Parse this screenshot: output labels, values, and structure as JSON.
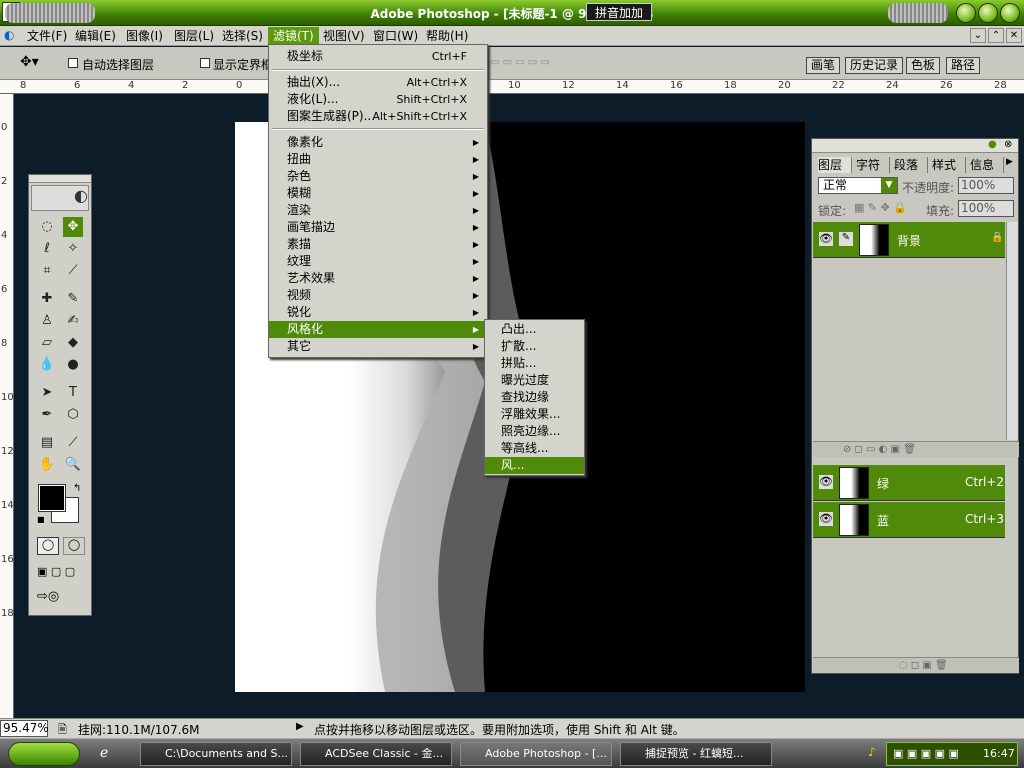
{
  "window": {
    "title": "Adobe Photoshop - [未标题-1 @ 95.5%(RGB",
    "ime_label": "拼音加加"
  },
  "menubar": {
    "items": [
      "文件(F)",
      "编辑(E)",
      "图像(I)",
      "图层(L)",
      "选择(S)",
      "滤镜(T)",
      "视图(V)",
      "窗口(W)",
      "帮助(H)"
    ],
    "active": "滤镜(T)"
  },
  "options": {
    "auto_select": "自动选择图层",
    "show_bounds": "显示定界框",
    "palette_tabs": [
      "画笔",
      "历史记录",
      "色板",
      "路径"
    ]
  },
  "rulers": {
    "top": [
      "8",
      "6",
      "4",
      "2",
      "0",
      "10",
      "12",
      "14",
      "16",
      "18",
      "20",
      "22",
      "24",
      "26",
      "28"
    ],
    "left": [
      "0",
      "2",
      "4",
      "6",
      "8",
      "10",
      "12",
      "14",
      "16",
      "18"
    ]
  },
  "filter_menu": {
    "top_items": [
      {
        "label": "极坐标",
        "shortcut": "Ctrl+F"
      }
    ],
    "mid_items": [
      {
        "label": "抽出(X)...",
        "shortcut": "Alt+Ctrl+X"
      },
      {
        "label": "液化(L)...",
        "shortcut": "Shift+Ctrl+X"
      },
      {
        "label": "图案生成器(P)...",
        "shortcut": "Alt+Shift+Ctrl+X"
      }
    ],
    "sub_items": [
      "像素化",
      "扭曲",
      "杂色",
      "模糊",
      "渲染",
      "画笔描边",
      "素描",
      "纹理",
      "艺术效果",
      "视频",
      "锐化",
      "风格化",
      "其它"
    ],
    "highlighted": "风格化"
  },
  "stylize_submenu": {
    "items": [
      "凸出...",
      "扩散...",
      "拼贴...",
      "曝光过度",
      "查找边缘",
      "浮雕效果...",
      "照亮边缘...",
      "等高线...",
      "风..."
    ],
    "highlighted": "风..."
  },
  "layers_panel": {
    "tabs": [
      "图层",
      "字符",
      "段落",
      "样式",
      "信息"
    ],
    "blend_mode": "正常",
    "opacity_label": "不透明度:",
    "opacity": "100%",
    "lock_label": "锁定:",
    "fill_label": "填充:",
    "fill": "100%",
    "layers": [
      {
        "name": "背景"
      }
    ],
    "channels": [
      {
        "name": "绿",
        "shortcut": "Ctrl+2"
      },
      {
        "name": "蓝",
        "shortcut": "Ctrl+3"
      }
    ]
  },
  "status": {
    "zoom": "95.47%",
    "doc": "挂网:110.1M/107.6M",
    "hint": "点按并拖移以移动图层或选区。要用附加选项，使用 Shift 和 Alt 键。"
  },
  "taskbar": {
    "tasks": [
      "C:\\Documents and S...",
      "ACDSee Classic - 金...",
      "Adobe Photoshop - [...",
      "捕捉预览 - 红螭短..."
    ],
    "active_index": 2,
    "clock": "16:47"
  },
  "colors": {
    "accent": "#4f8a0a",
    "background": "#0c1c28"
  }
}
